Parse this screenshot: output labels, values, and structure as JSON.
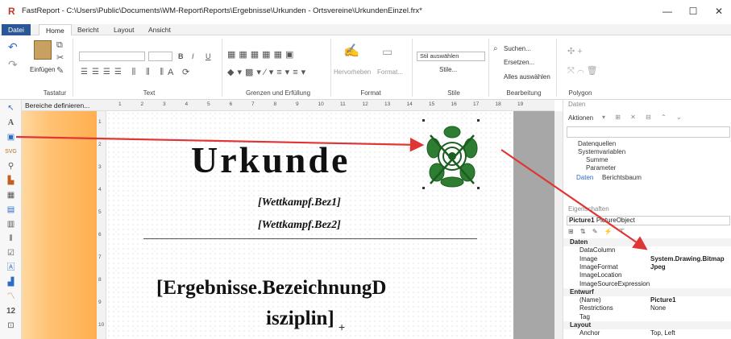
{
  "window": {
    "app_icon": "R",
    "title": "FastReport - C:\\Users\\Public\\Documents\\WM-Report\\Reports\\Ergebnisse\\Urkunden - Ortsvereine\\UrkundenEinzel.frx*",
    "minimize": "—",
    "maximize": "☐",
    "close": "✕"
  },
  "ribbon_tabs": [
    "Datei",
    "Home",
    "Bericht",
    "Layout",
    "Ansicht"
  ],
  "ribbon": {
    "groups": {
      "tastatur": "Tastatur",
      "text": "Text",
      "grenzen": "Grenzen und Erfüllung",
      "format": "Format",
      "stile": "Stile",
      "bearbeitung": "Bearbeitung",
      "polygon": "Polygon"
    },
    "einfuegen": "Einfügen",
    "hervorheben": "Hervorheben",
    "format_btn": "Format...",
    "stil_dropdown": "Stil auswählen",
    "stile_btn": "Stile...",
    "suchen": "Suchen...",
    "ersetzen": "Ersetzen...",
    "alles_auswaehlen": "Alles auswählen",
    "bold": "B",
    "italic": "I",
    "underline": "U"
  },
  "band_header": "Bereiche definieren...",
  "hruler_ticks": [
    "1",
    "2",
    "3",
    "4",
    "5",
    "6",
    "7",
    "8",
    "9",
    "10",
    "11",
    "12",
    "13",
    "14",
    "15",
    "16",
    "17",
    "18",
    "19"
  ],
  "vruler_ticks": [
    "1",
    "2",
    "3",
    "4",
    "5",
    "6",
    "7",
    "8",
    "9",
    "10"
  ],
  "document": {
    "title": "Urkunde",
    "line1": "[Wettkampf.Bez1]",
    "line2": "[Wettkampf.Bez2]",
    "field_line1": "[Ergebnisse.BezeichnungD",
    "field_line2": "isziplin]"
  },
  "data_panel": {
    "header": "Daten",
    "aktionen": "Aktionen",
    "tree": [
      "Datenquellen",
      "Systemvariablen",
      "Summe",
      "Parameter"
    ],
    "tab_daten": "Daten",
    "tab_berichtsbaum": "Berichtsbaum"
  },
  "props_panel": {
    "header": "Eigenschaften",
    "object_name": "Picture1",
    "object_type": "PictureObject",
    "rows": [
      {
        "cat": true,
        "k": "Daten",
        "v": ""
      },
      {
        "cat": false,
        "k": "DataColumn",
        "v": ""
      },
      {
        "cat": false,
        "k": "Image",
        "v": "System.Drawing.Bitmap",
        "bold": true
      },
      {
        "cat": false,
        "k": "ImageFormat",
        "v": "Jpeg",
        "bold": true
      },
      {
        "cat": false,
        "k": "ImageLocation",
        "v": ""
      },
      {
        "cat": false,
        "k": "ImageSourceExpression",
        "v": ""
      },
      {
        "cat": true,
        "k": "Entwurf",
        "v": ""
      },
      {
        "cat": false,
        "k": "(Name)",
        "v": "Picture1",
        "bold": true
      },
      {
        "cat": false,
        "k": "Restrictions",
        "v": "None"
      },
      {
        "cat": false,
        "k": "Tag",
        "v": ""
      },
      {
        "cat": true,
        "k": "Layout",
        "v": ""
      },
      {
        "cat": false,
        "k": "Anchor",
        "v": "Top, Left"
      }
    ]
  },
  "colors": {
    "arrow": "#e03535",
    "band": "#ffc070",
    "file_tab": "#2b5797",
    "emblem": "#2e7d32"
  },
  "icons": [
    "undo-icon",
    "redo-icon",
    "paste-icon",
    "picture-tool-icon",
    "pointer-icon",
    "text-tool-icon",
    "target-emblem-icon"
  ]
}
